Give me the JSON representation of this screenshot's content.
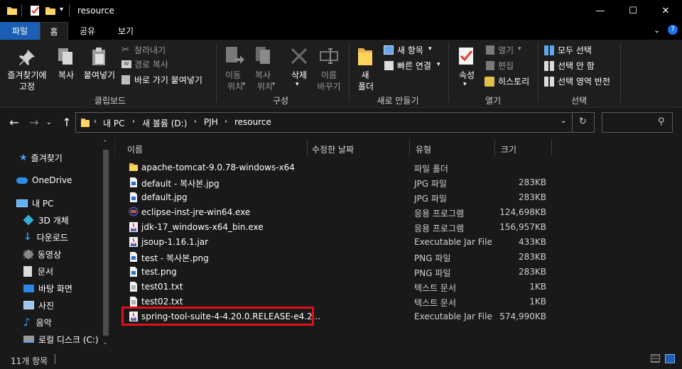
{
  "window": {
    "title": "resource",
    "minimize": "—",
    "maximize": "☐",
    "close": "✕"
  },
  "menu": {
    "file": "파일",
    "home": "홈",
    "share": "공유",
    "view": "보기"
  },
  "ribbon": {
    "clipboard": {
      "pin_label_line1": "즐겨찾기에",
      "pin_label_line2": "고정",
      "copy": "복사",
      "paste": "붙여넣기",
      "cut": "잘라내기",
      "copy_path": "경로 복사",
      "paste_shortcut": "바로 가기 붙여넣기",
      "group": "클립보드"
    },
    "organize": {
      "move_line1": "이동",
      "move_line2": "위치",
      "copyto_line1": "복사",
      "copyto_line2": "위치",
      "delete": "삭제",
      "rename_line1": "이름",
      "rename_line2": "바꾸기",
      "group": "구성"
    },
    "new": {
      "folder_line1": "새",
      "folder_line2": "폴더",
      "new_item": "새 항목",
      "easy_access": "빠른 연결",
      "group": "새로 만들기"
    },
    "open": {
      "properties": "속성",
      "open": "열기",
      "edit": "편집",
      "history": "히스토리",
      "group": "열기"
    },
    "select": {
      "select_all": "모두 선택",
      "select_none": "선택 안 함",
      "invert": "선택 영역 반전",
      "group": "선택"
    }
  },
  "address": {
    "crumbs": [
      "내 PC",
      "새 볼륨 (D:)",
      "PJH",
      "resource"
    ]
  },
  "nav": {
    "quick": "즐겨찾기",
    "onedrive": "OneDrive",
    "mypc": "내 PC",
    "objects3d": "3D 개체",
    "downloads": "다운로드",
    "videos": "동영상",
    "documents": "문서",
    "desktop": "바탕 화면",
    "pictures": "사진",
    "music": "음악",
    "localdisk": "로컬 디스크 (C:)"
  },
  "columns": {
    "name": "이름",
    "modified": "수정한 날짜",
    "type": "유형",
    "size": "크기"
  },
  "files": [
    {
      "name": "apache-tomcat-9.0.78-windows-x64",
      "type": "파일 폴더",
      "size": "",
      "icon": "folder-icon"
    },
    {
      "name": "default - 복사본.jpg",
      "type": "JPG 파일",
      "size": "283KB",
      "icon": "image-file-icon"
    },
    {
      "name": "default.jpg",
      "type": "JPG 파일",
      "size": "283KB",
      "icon": "image-file-icon"
    },
    {
      "name": "eclipse-inst-jre-win64.exe",
      "type": "응용 프로그램",
      "size": "124,698KB",
      "icon": "eclipse-icon"
    },
    {
      "name": "jdk-17_windows-x64_bin.exe",
      "type": "응용 프로그램",
      "size": "156,957KB",
      "icon": "java-icon"
    },
    {
      "name": "jsoup-1.16.1.jar",
      "type": "Executable Jar File",
      "size": "433KB",
      "icon": "java-icon"
    },
    {
      "name": "test - 복사본.png",
      "type": "PNG 파일",
      "size": "283KB",
      "icon": "image-file-icon"
    },
    {
      "name": "test.png",
      "type": "PNG 파일",
      "size": "283KB",
      "icon": "image-file-icon"
    },
    {
      "name": "test01.txt",
      "type": "텍스트 문서",
      "size": "1KB",
      "icon": "text-file-icon"
    },
    {
      "name": "test02.txt",
      "type": "텍스트 문서",
      "size": "1KB",
      "icon": "text-file-icon"
    },
    {
      "name": "spring-tool-suite-4-4.20.0.RELEASE-e4.2...",
      "type": "Executable Jar File",
      "size": "574,990KB",
      "icon": "java-icon",
      "highlighted": true
    }
  ],
  "status": {
    "count": "11개 항목"
  },
  "colors": {
    "accent": "#0a5fb4",
    "highlight_border": "#e0101a"
  }
}
